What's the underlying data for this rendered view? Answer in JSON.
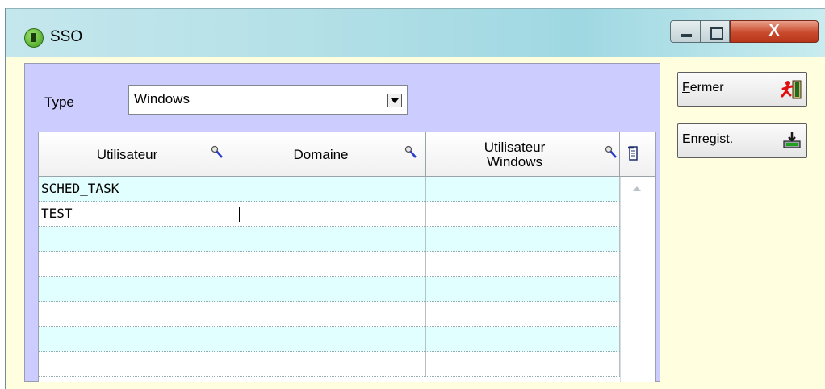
{
  "window": {
    "title": "SSO",
    "controls": {
      "close_label": "X"
    }
  },
  "form": {
    "type_label": "Type",
    "type_value": "Windows"
  },
  "table": {
    "columns": [
      {
        "label": "Utilisateur"
      },
      {
        "label": "Domaine"
      },
      {
        "label_line1": "Utilisateur",
        "label_line2": "Windows"
      }
    ],
    "rows": [
      {
        "user": "SCHED_TASK",
        "domain": "",
        "windows_user": ""
      },
      {
        "user": "TEST",
        "domain": "",
        "windows_user": ""
      },
      {
        "user": "",
        "domain": "",
        "windows_user": ""
      },
      {
        "user": "",
        "domain": "",
        "windows_user": ""
      },
      {
        "user": "",
        "domain": "",
        "windows_user": ""
      },
      {
        "user": "",
        "domain": "",
        "windows_user": ""
      },
      {
        "user": "",
        "domain": "",
        "windows_user": ""
      },
      {
        "user": "",
        "domain": "",
        "windows_user": ""
      }
    ]
  },
  "actions": {
    "close": {
      "accel": "F",
      "rest": "ermer"
    },
    "save": {
      "accel": "E",
      "rest": "nregist."
    }
  },
  "colors": {
    "row_alt": "#e0fffe",
    "panel": "#ccccfe",
    "window_body": "#ffffe0"
  },
  "icons": {
    "app": "sso-app-icon",
    "column_search": "magnifier-icon",
    "export": "export-icon",
    "close_action": "exit-runner-icon",
    "save_action": "save-tray-icon"
  }
}
